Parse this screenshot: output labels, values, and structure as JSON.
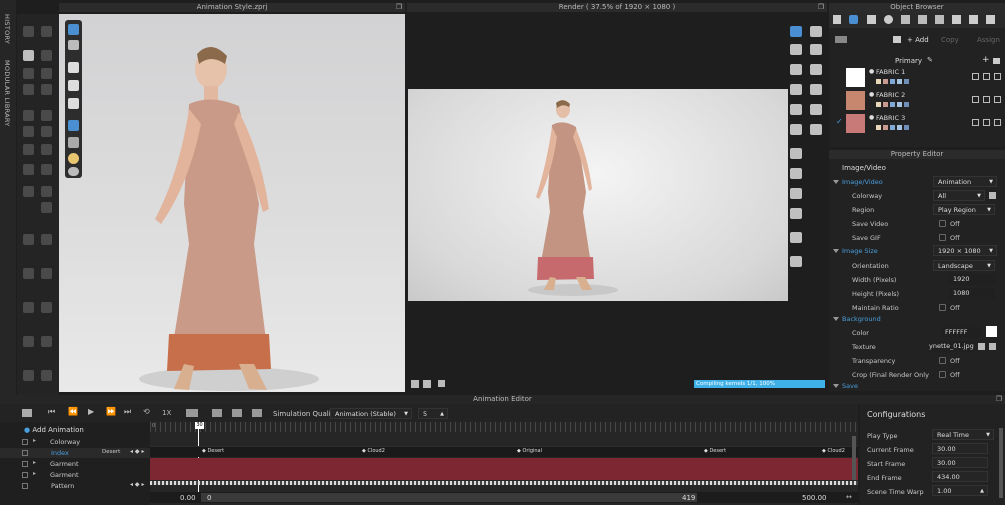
{
  "left_sidebar": {
    "history_label": "HISTORY",
    "modular_label": "MODULAR LIBRARY"
  },
  "viewport3d": {
    "title": "Animation Style.zprj"
  },
  "render_panel": {
    "title": "Render ( 37.5% of 1920 × 1080 )",
    "progress_text": "Compiling kernels 1/1, 100%",
    "progress": 1.0
  },
  "object_browser": {
    "title": "Object Browser",
    "add_label": "+ Add",
    "copy_label": "Copy",
    "assign_label": "Assign",
    "colorway": "Primary",
    "fabrics": [
      {
        "name": "FABRIC 1",
        "thumb_color": "#ffffff",
        "selected": false
      },
      {
        "name": "FABRIC 2",
        "thumb_color": "#c7876f",
        "selected": false
      },
      {
        "name": "FABRIC 3",
        "thumb_color": "#c77a78",
        "selected": true
      }
    ]
  },
  "property_editor": {
    "title": "Property Editor",
    "section_header": "Image/Video",
    "image_video": {
      "label": "Image/Video",
      "value": "Animation"
    },
    "colorway": {
      "label": "Colorway",
      "value": "All"
    },
    "region": {
      "label": "Region",
      "value": "Play Region"
    },
    "save_video": {
      "label": "Save Video",
      "value": "Off"
    },
    "save_gif": {
      "label": "Save GIF",
      "value": "Off"
    },
    "image_size": {
      "label": "Image Size",
      "value": "1920 × 1080"
    },
    "orientation": {
      "label": "Orientation",
      "value": "Landscape"
    },
    "width": {
      "label": "Width (Pixels)",
      "value": "1920"
    },
    "height": {
      "label": "Height (Pixels)",
      "value": "1080"
    },
    "maintain_ratio": {
      "label": "Maintain Ratio",
      "value": "Off"
    },
    "background": {
      "label": "Background"
    },
    "color": {
      "label": "Color",
      "value": "FFFFFF"
    },
    "texture": {
      "label": "Texture",
      "value": "ynette_01.jpg"
    },
    "transparency": {
      "label": "Transparency",
      "value": "Off"
    },
    "crop": {
      "label": "Crop (Final Render Only",
      "value": "Off"
    },
    "save": {
      "label": "Save"
    }
  },
  "animation_editor": {
    "title": "Animation Editor",
    "speed_label": "1X",
    "sim_quality_label": "Simulation Quality",
    "sim_quality_value": "Animation (Stable)",
    "sim_number": "5",
    "add_animation": "Add Animation",
    "tracks": [
      {
        "label": "Colorway",
        "extra": ""
      },
      {
        "label": "Index",
        "extra": "Desert"
      },
      {
        "label": "Garment",
        "extra": ""
      },
      {
        "label": "Garment",
        "extra": ""
      },
      {
        "label": "Pattern",
        "extra": ""
      }
    ],
    "keys": [
      "Desert",
      "Cloud2",
      "Original",
      "Desert",
      "Cloud2"
    ],
    "ruler_start": "0",
    "playhead": "30",
    "range_start": "0.00",
    "range_mid_left": "0",
    "range_mid_right": "419",
    "range_end": "500.00"
  },
  "configurations": {
    "title": "Configurations",
    "play_type": {
      "label": "Play Type",
      "value": "Real Time"
    },
    "current_frame": {
      "label": "Current Frame",
      "value": "30.00"
    },
    "start_frame": {
      "label": "Start Frame",
      "value": "30.00"
    },
    "end_frame": {
      "label": "End Frame",
      "value": "434.00"
    },
    "scene_time_warp": {
      "label": "Scene Time Warp",
      "value": "1.00"
    }
  }
}
